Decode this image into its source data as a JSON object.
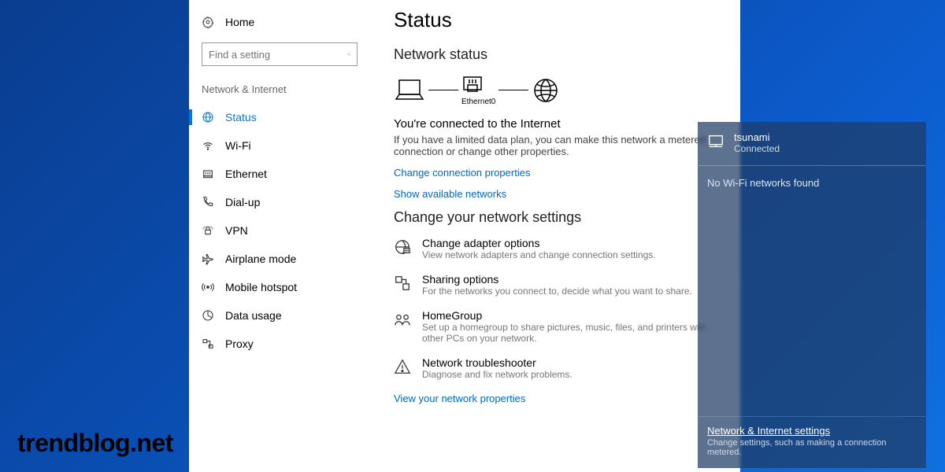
{
  "sidebar": {
    "home": "Home",
    "search_placeholder": "Find a setting",
    "group": "Network & Internet",
    "items": [
      {
        "label": "Status"
      },
      {
        "label": "Wi-Fi"
      },
      {
        "label": "Ethernet"
      },
      {
        "label": "Dial-up"
      },
      {
        "label": "VPN"
      },
      {
        "label": "Airplane mode"
      },
      {
        "label": "Mobile hotspot"
      },
      {
        "label": "Data usage"
      },
      {
        "label": "Proxy"
      }
    ]
  },
  "content": {
    "title": "Status",
    "subtitle": "Network status",
    "diagram_label": "Ethernet0",
    "connected_heading": "You're connected to the Internet",
    "connected_body": "If you have a limited data plan, you can make this network a metered connection or change other properties.",
    "link_change_props": "Change connection properties",
    "link_show_networks": "Show available networks",
    "change_heading": "Change your network settings",
    "options": [
      {
        "title": "Change adapter options",
        "desc": "View network adapters and change connection settings."
      },
      {
        "title": "Sharing options",
        "desc": "For the networks you connect to, decide what you want to share."
      },
      {
        "title": "HomeGroup",
        "desc": "Set up a homegroup to share pictures, music, files, and printers with other PCs on your network."
      },
      {
        "title": "Network troubleshooter",
        "desc": "Diagnose and fix network problems."
      }
    ],
    "link_view_props": "View your network properties"
  },
  "flyout": {
    "network_name": "tsunami",
    "network_status": "Connected",
    "no_wifi": "No Wi-Fi networks found",
    "footer_title": "Network & Internet settings",
    "footer_desc": "Change settings, such as making a connection metered."
  },
  "watermark": "trendblog.net"
}
